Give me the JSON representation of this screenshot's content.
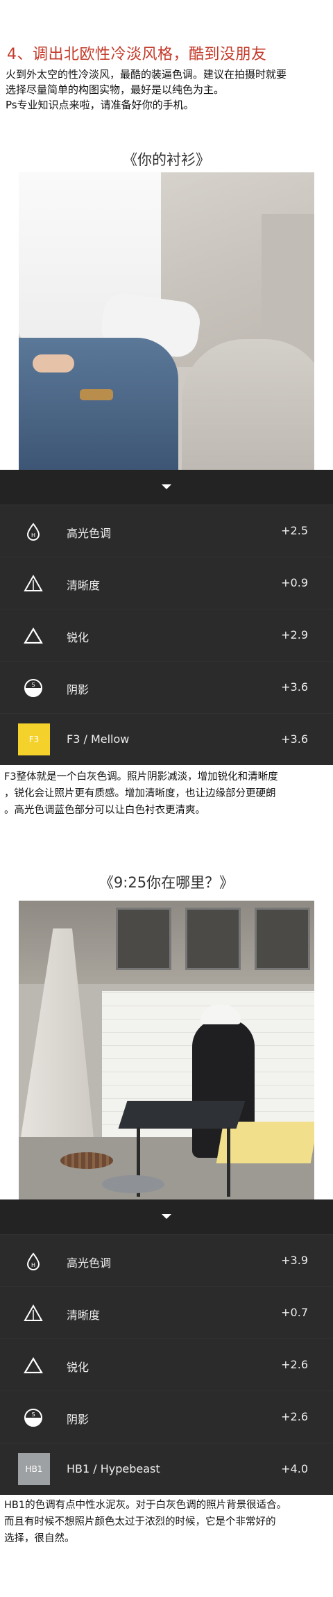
{
  "heading": "4、调出北欧性冷淡风格，酷到没朋友",
  "intro": [
    "火到外太空的性冷淡风，最酷的装逼色调。建议在拍摄时就要",
    "选择尽量简单的构图实物，最好是以纯色为主。",
    "Ps专业知识点来啦，请准备好你的手机。"
  ],
  "section1": {
    "title": "《你的衬衫》",
    "adjustments": [
      {
        "icon": "highlight-tone-icon",
        "label": "高光色调",
        "value": "+2.5"
      },
      {
        "icon": "clarity-icon",
        "label": "清晰度",
        "value": "+0.9"
      },
      {
        "icon": "sharpen-icon",
        "label": "锐化",
        "value": "+2.9"
      },
      {
        "icon": "shadow-icon",
        "label": "阴影",
        "value": "+3.6"
      }
    ],
    "filter": {
      "code": "F3",
      "label": "F3 / Mellow",
      "value": "+3.6",
      "color": "#f4d22b"
    },
    "description": [
      "F3整体就是一个白灰色调。照片阴影减淡，增加锐化和清晰度",
      "，锐化会让照片更有质感。增加清晰度，也让边缘部分更硬朗",
      "。高光色调蓝色部分可以让白色衬衣更清爽。"
    ]
  },
  "section2": {
    "title": "《9:25你在哪里？》",
    "adjustments": [
      {
        "icon": "highlight-tone-icon",
        "label": "高光色调",
        "value": "+3.9"
      },
      {
        "icon": "clarity-icon",
        "label": "清晰度",
        "value": "+0.7"
      },
      {
        "icon": "sharpen-icon",
        "label": "锐化",
        "value": "+2.6"
      },
      {
        "icon": "shadow-icon",
        "label": "阴影",
        "value": "+2.6"
      }
    ],
    "filter": {
      "code": "HB1",
      "label": "HB1 / Hypebeast",
      "value": "+4.0",
      "color": "#9ea1a3"
    },
    "description": [
      "HB1的色调有点中性水泥灰。对于白灰色调的照片背景很适合。",
      "而且有时候不想照片颜色太过于浓烈的时候，它是个非常好的",
      "选择，很自然。"
    ]
  },
  "colors": {
    "accent": "#c43a2a",
    "panel": "#2b2b2b"
  }
}
